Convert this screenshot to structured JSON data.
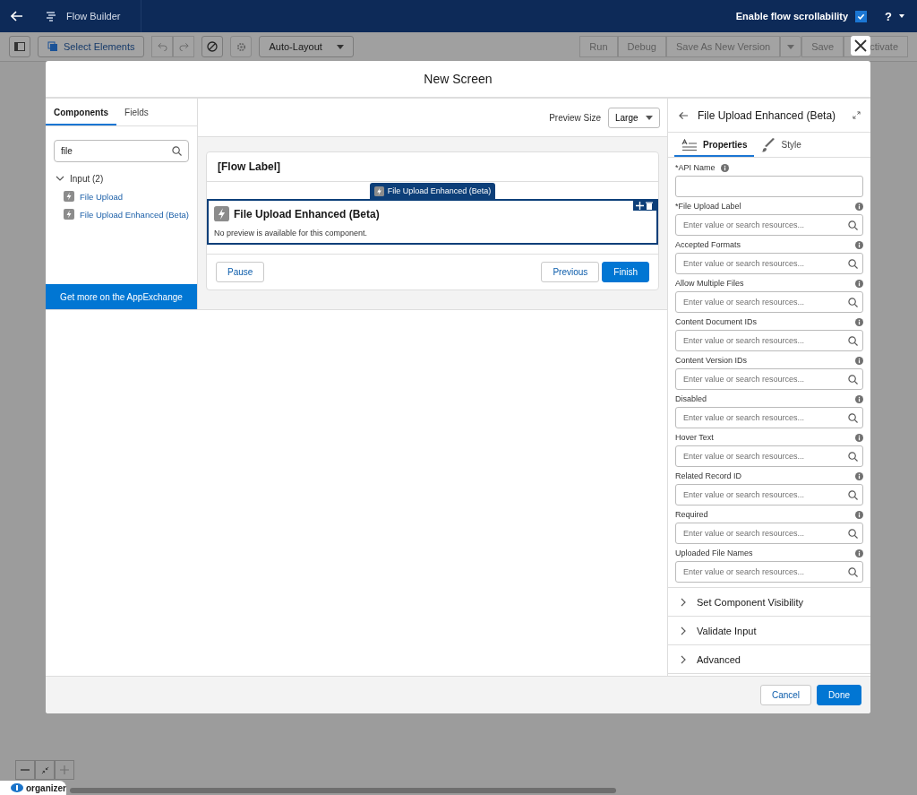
{
  "app_bar": {
    "title": "Flow Builder",
    "scroll_toggle": {
      "label": "Enable flow scrollability",
      "checked": true
    },
    "help": "?"
  },
  "toolbar": {
    "select_elements": "Select Elements",
    "layout": "Auto-Layout",
    "buttons": [
      {
        "label": "Run",
        "disabled": true
      },
      {
        "label": "Debug",
        "disabled": true
      },
      {
        "label": "Save As New Version",
        "disabled": true
      },
      {
        "label": "Save",
        "disabled": true
      },
      {
        "label": "ctivate",
        "disabled": true
      }
    ]
  },
  "modal": {
    "title": "New Screen",
    "left": {
      "tabs": [
        {
          "label": "Components",
          "selected": true
        },
        {
          "label": "Fields",
          "selected": false
        }
      ],
      "search": {
        "value": "file"
      },
      "group": {
        "label": "Input (2)",
        "expanded": true,
        "children": [
          {
            "label": "File Upload"
          },
          {
            "label": "File Upload Enhanced (Beta)"
          }
        ]
      },
      "appexchange": "Get more on the AppExchange"
    },
    "preview": {
      "label": "Preview Size",
      "value": "Large"
    },
    "screen": {
      "header": "[Flow Label]",
      "component_tab": "File Upload Enhanced (Beta)",
      "component_title": "File Upload Enhanced (Beta)",
      "message": "No preview is available for this component.",
      "left_buttons": [
        {
          "label": "Pause",
          "kind": "neutral"
        }
      ],
      "right_buttons": [
        {
          "label": "Previous",
          "kind": "neutral"
        },
        {
          "label": "Finish",
          "kind": "brand"
        }
      ]
    },
    "properties": {
      "title": "File Upload Enhanced (Beta)",
      "tabs": [
        {
          "label": "Properties",
          "selected": true
        },
        {
          "label": "Style",
          "selected": false
        }
      ],
      "fields": [
        {
          "label": "*API Name",
          "kind": "text"
        },
        {
          "label": "*File Upload Label",
          "kind": "resource",
          "placeholder": "Enter value or search resources..."
        },
        {
          "label": "Accepted Formats",
          "kind": "resource",
          "placeholder": "Enter value or search resources..."
        },
        {
          "label": "Allow Multiple Files",
          "kind": "resource",
          "placeholder": "Enter value or search resources..."
        },
        {
          "label": "Content Document IDs",
          "kind": "resource",
          "placeholder": "Enter value or search resources..."
        },
        {
          "label": "Content Version IDs",
          "kind": "resource",
          "placeholder": "Enter value or search resources..."
        },
        {
          "label": "Disabled",
          "kind": "resource",
          "placeholder": "Enter value or search resources..."
        },
        {
          "label": "Hover Text",
          "kind": "resource",
          "placeholder": "Enter value or search resources..."
        },
        {
          "label": "Related Record ID",
          "kind": "resource",
          "placeholder": "Enter value or search resources..."
        },
        {
          "label": "Required",
          "kind": "resource",
          "placeholder": "Enter value or search resources..."
        },
        {
          "label": "Uploaded File Names",
          "kind": "resource",
          "placeholder": "Enter value or search resources..."
        }
      ],
      "sections": [
        {
          "label": "Set Component Visibility",
          "expanded": false
        },
        {
          "label": "Validate Input",
          "expanded": false
        },
        {
          "label": "Advanced",
          "expanded": false
        }
      ]
    },
    "footer": {
      "buttons": [
        {
          "label": "Cancel",
          "kind": "neutral"
        },
        {
          "label": "Done",
          "kind": "brand"
        }
      ]
    }
  },
  "canvas": {
    "badge": "organizer"
  }
}
